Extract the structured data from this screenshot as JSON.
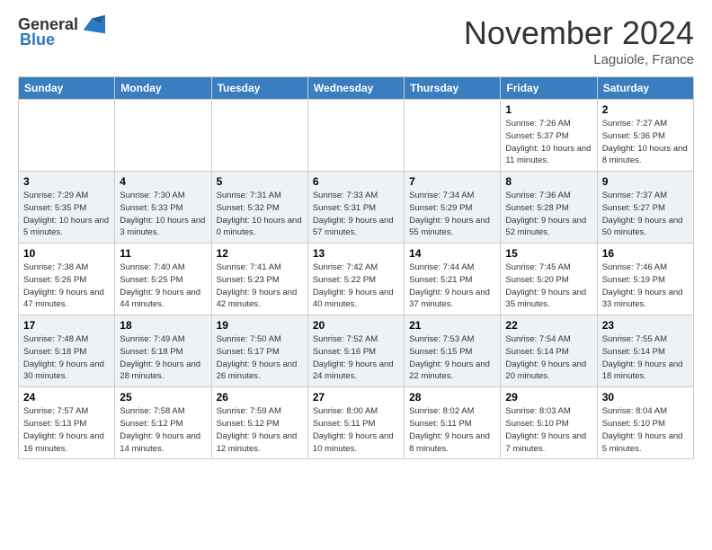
{
  "header": {
    "logo_general": "General",
    "logo_blue": "Blue",
    "month_title": "November 2024",
    "location": "Laguiole, France"
  },
  "weekdays": [
    "Sunday",
    "Monday",
    "Tuesday",
    "Wednesday",
    "Thursday",
    "Friday",
    "Saturday"
  ],
  "weeks": [
    [
      {
        "day": "",
        "info": ""
      },
      {
        "day": "",
        "info": ""
      },
      {
        "day": "",
        "info": ""
      },
      {
        "day": "",
        "info": ""
      },
      {
        "day": "",
        "info": ""
      },
      {
        "day": "1",
        "info": "Sunrise: 7:26 AM\nSunset: 5:37 PM\nDaylight: 10 hours and 11 minutes."
      },
      {
        "day": "2",
        "info": "Sunrise: 7:27 AM\nSunset: 5:36 PM\nDaylight: 10 hours and 8 minutes."
      }
    ],
    [
      {
        "day": "3",
        "info": "Sunrise: 7:29 AM\nSunset: 5:35 PM\nDaylight: 10 hours and 5 minutes."
      },
      {
        "day": "4",
        "info": "Sunrise: 7:30 AM\nSunset: 5:33 PM\nDaylight: 10 hours and 3 minutes."
      },
      {
        "day": "5",
        "info": "Sunrise: 7:31 AM\nSunset: 5:32 PM\nDaylight: 10 hours and 0 minutes."
      },
      {
        "day": "6",
        "info": "Sunrise: 7:33 AM\nSunset: 5:31 PM\nDaylight: 9 hours and 57 minutes."
      },
      {
        "day": "7",
        "info": "Sunrise: 7:34 AM\nSunset: 5:29 PM\nDaylight: 9 hours and 55 minutes."
      },
      {
        "day": "8",
        "info": "Sunrise: 7:36 AM\nSunset: 5:28 PM\nDaylight: 9 hours and 52 minutes."
      },
      {
        "day": "9",
        "info": "Sunrise: 7:37 AM\nSunset: 5:27 PM\nDaylight: 9 hours and 50 minutes."
      }
    ],
    [
      {
        "day": "10",
        "info": "Sunrise: 7:38 AM\nSunset: 5:26 PM\nDaylight: 9 hours and 47 minutes."
      },
      {
        "day": "11",
        "info": "Sunrise: 7:40 AM\nSunset: 5:25 PM\nDaylight: 9 hours and 44 minutes."
      },
      {
        "day": "12",
        "info": "Sunrise: 7:41 AM\nSunset: 5:23 PM\nDaylight: 9 hours and 42 minutes."
      },
      {
        "day": "13",
        "info": "Sunrise: 7:42 AM\nSunset: 5:22 PM\nDaylight: 9 hours and 40 minutes."
      },
      {
        "day": "14",
        "info": "Sunrise: 7:44 AM\nSunset: 5:21 PM\nDaylight: 9 hours and 37 minutes."
      },
      {
        "day": "15",
        "info": "Sunrise: 7:45 AM\nSunset: 5:20 PM\nDaylight: 9 hours and 35 minutes."
      },
      {
        "day": "16",
        "info": "Sunrise: 7:46 AM\nSunset: 5:19 PM\nDaylight: 9 hours and 33 minutes."
      }
    ],
    [
      {
        "day": "17",
        "info": "Sunrise: 7:48 AM\nSunset: 5:18 PM\nDaylight: 9 hours and 30 minutes."
      },
      {
        "day": "18",
        "info": "Sunrise: 7:49 AM\nSunset: 5:18 PM\nDaylight: 9 hours and 28 minutes."
      },
      {
        "day": "19",
        "info": "Sunrise: 7:50 AM\nSunset: 5:17 PM\nDaylight: 9 hours and 26 minutes."
      },
      {
        "day": "20",
        "info": "Sunrise: 7:52 AM\nSunset: 5:16 PM\nDaylight: 9 hours and 24 minutes."
      },
      {
        "day": "21",
        "info": "Sunrise: 7:53 AM\nSunset: 5:15 PM\nDaylight: 9 hours and 22 minutes."
      },
      {
        "day": "22",
        "info": "Sunrise: 7:54 AM\nSunset: 5:14 PM\nDaylight: 9 hours and 20 minutes."
      },
      {
        "day": "23",
        "info": "Sunrise: 7:55 AM\nSunset: 5:14 PM\nDaylight: 9 hours and 18 minutes."
      }
    ],
    [
      {
        "day": "24",
        "info": "Sunrise: 7:57 AM\nSunset: 5:13 PM\nDaylight: 9 hours and 16 minutes."
      },
      {
        "day": "25",
        "info": "Sunrise: 7:58 AM\nSunset: 5:12 PM\nDaylight: 9 hours and 14 minutes."
      },
      {
        "day": "26",
        "info": "Sunrise: 7:59 AM\nSunset: 5:12 PM\nDaylight: 9 hours and 12 minutes."
      },
      {
        "day": "27",
        "info": "Sunrise: 8:00 AM\nSunset: 5:11 PM\nDaylight: 9 hours and 10 minutes."
      },
      {
        "day": "28",
        "info": "Sunrise: 8:02 AM\nSunset: 5:11 PM\nDaylight: 9 hours and 8 minutes."
      },
      {
        "day": "29",
        "info": "Sunrise: 8:03 AM\nSunset: 5:10 PM\nDaylight: 9 hours and 7 minutes."
      },
      {
        "day": "30",
        "info": "Sunrise: 8:04 AM\nSunset: 5:10 PM\nDaylight: 9 hours and 5 minutes."
      }
    ]
  ]
}
